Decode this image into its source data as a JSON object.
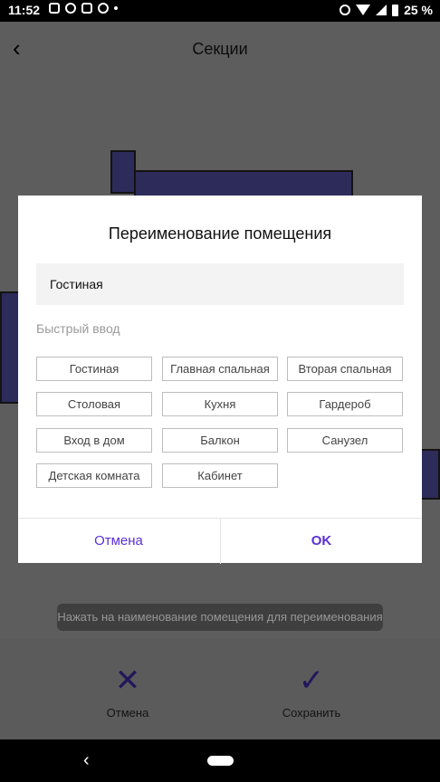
{
  "status": {
    "time": "11:52",
    "battery": "25 %"
  },
  "appbar": {
    "title": "Секции"
  },
  "hint": "Нажать на наименование помещения для переименования",
  "bottom": {
    "cancel_label": "Отмена",
    "save_label": "Сохранить"
  },
  "dialog": {
    "title": "Переименование помещения",
    "input_value": "Гостиная",
    "quick_label": "Быстрый ввод",
    "chips": [
      "Гостиная",
      "Главная спальная",
      "Вторая спальная",
      "Столовая",
      "Кухня",
      "Гардероб",
      "Вход в дом",
      "Балкон",
      "Санузел",
      "Детская комната",
      "Кабинет"
    ],
    "cancel_label": "Отмена",
    "ok_label": "OK"
  },
  "colors": {
    "accent": "#5a2fd6",
    "room": "#3d3a78"
  }
}
